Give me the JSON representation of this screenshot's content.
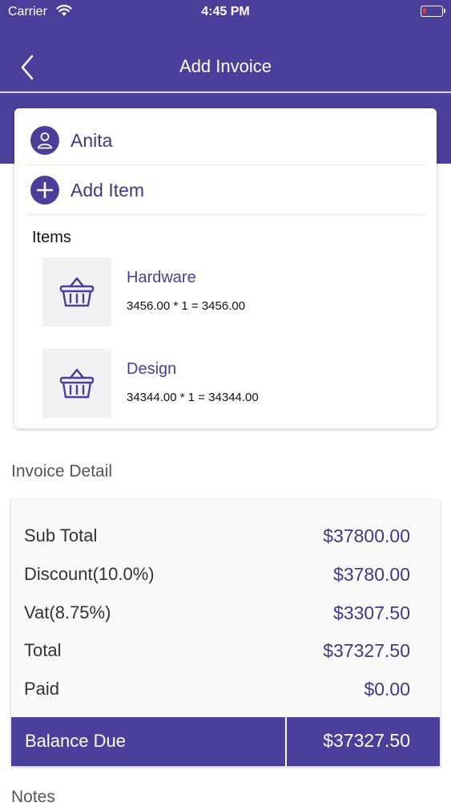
{
  "status_bar": {
    "carrier": "Carrier",
    "time": "4:45 PM"
  },
  "nav": {
    "title": "Add Invoice"
  },
  "customer": {
    "name": "Anita"
  },
  "add_item": {
    "label": "Add Item"
  },
  "items_section": {
    "heading": "Items",
    "items": [
      {
        "name": "Hardware",
        "calc": "3456.00 * 1 = 3456.00"
      },
      {
        "name": "Design",
        "calc": "34344.00 * 1 = 34344.00"
      }
    ]
  },
  "invoice_detail": {
    "title": "Invoice Detail",
    "rows": [
      {
        "label": "Sub Total",
        "value": "$37800.00"
      },
      {
        "label": "Discount(10.0%)",
        "value": "$3780.00"
      },
      {
        "label": "Vat(8.75%)",
        "value": "$3307.50"
      },
      {
        "label": "Total",
        "value": "$37327.50"
      },
      {
        "label": "Paid",
        "value": "$0.00"
      }
    ],
    "balance_label": "Balance Due",
    "balance_value": "$37327.50"
  },
  "notes": {
    "title": "Notes"
  },
  "colors": {
    "primary": "#4a3f9b",
    "battery_low": "#e53935"
  }
}
